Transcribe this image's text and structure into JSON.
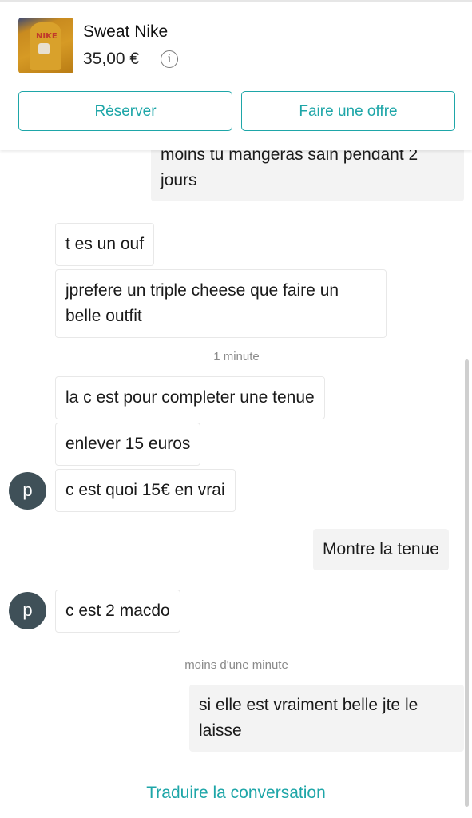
{
  "item": {
    "title": "Sweat Nike",
    "price": "35,00 €",
    "info_icon": "i",
    "image_logo_text": "NIKE"
  },
  "actions": {
    "reserve_label": "Réserver",
    "offer_label": "Faire une offre"
  },
  "messages": {
    "m1_line1": "moins tu mangeras sain pendant 2",
    "m1_line2": "jours",
    "m2": "t es un ouf",
    "m3_line1": "jprefere un triple cheese que faire un",
    "m3_line2": "belle outfit",
    "time1": "1 minute",
    "m4": "la c est pour completer une tenue",
    "m5": "enlever 15 euros",
    "m6": "c est quoi 15€ en vrai",
    "m7": "Montre la tenue",
    "m8": "c est 2 macdo",
    "time2": "moins d'une minute",
    "m9_line1": "si elle est vraiment belle jte le",
    "m9_line2": "laisse"
  },
  "avatar_letter": "p",
  "footer": {
    "translate_label": "Traduire la conversation"
  },
  "colors": {
    "accent": "#1ea6a8",
    "avatar_bg": "#3f5058",
    "outgoing_bg": "#f3f3f3"
  }
}
